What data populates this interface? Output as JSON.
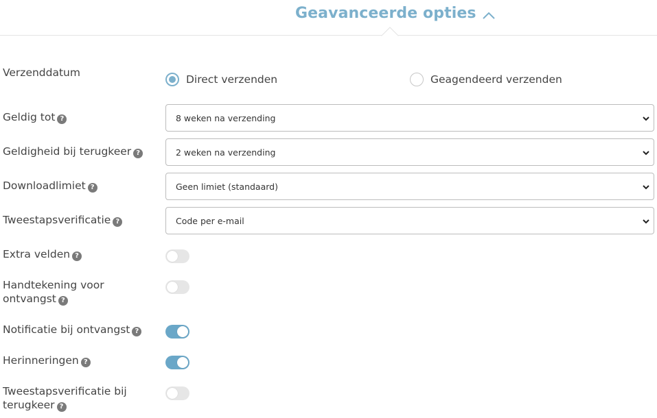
{
  "header": {
    "title": "Geavanceerde opties"
  },
  "accent_color": "#7cb0cc",
  "icons": {
    "help": "question-circle-icon",
    "collapse": "chevron-up-icon",
    "dropdown": "chevron-down-icon"
  },
  "send_date": {
    "label": "Verzenddatum",
    "options": [
      {
        "label": "Direct verzenden",
        "checked": true
      },
      {
        "label": "Geagendeerd verzenden",
        "checked": false
      }
    ]
  },
  "fields": {
    "valid_until": {
      "label": "Geldig tot",
      "value": "8 weken na verzending"
    },
    "valid_on_return": {
      "label": "Geldigheid bij terugkeer",
      "value": "2 weken na verzending"
    },
    "download_limit": {
      "label": "Downloadlimiet",
      "value": "Geen limiet (standaard)"
    },
    "two_step": {
      "label": "Tweestapsverificatie",
      "value": "Code per e-mail"
    }
  },
  "toggles": {
    "extra_fields": {
      "label": "Extra velden",
      "on": false
    },
    "signature": {
      "label_line1": "Handtekening voor",
      "label_line2": "ontvangst",
      "on": false
    },
    "notification": {
      "label": "Notificatie bij ontvangst",
      "on": true
    },
    "reminders": {
      "label": "Herinneringen",
      "on": true
    },
    "two_step_return": {
      "label_line1": "Tweestapsverificatie bij",
      "label_line2": "terugkeer",
      "on": false
    }
  }
}
